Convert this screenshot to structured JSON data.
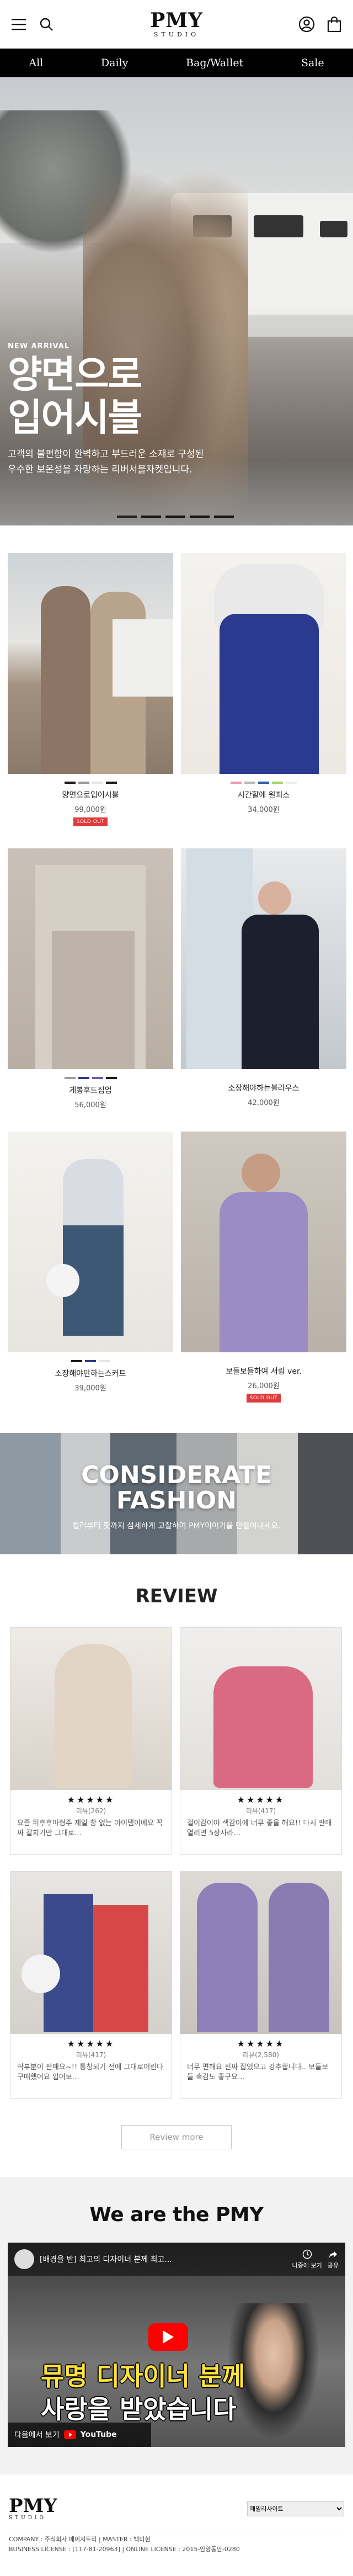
{
  "header": {
    "logo_main": "PMY",
    "logo_sub": "STUDIO"
  },
  "nav": {
    "items": [
      "All",
      "Daily",
      "Bag/Wallet",
      "Sale"
    ]
  },
  "hero": {
    "kicker": "NEW ARRIVAL",
    "title_line1": "양면으로",
    "title_line2": "입어시블",
    "desc_line1": "고객의 불편함이 완벽하고 부드러운 소재로 구성된",
    "desc_line2": "우수한 보온성을 자랑하는 리버서블자켓입니다."
  },
  "products": [
    {
      "name": "양면으로입어시블",
      "price": "99,000원",
      "soldout": "SOLD OUT",
      "swatches": [
        "#1a1a1a",
        "#9b9b9b",
        "#e7e7e7",
        "#1a1a1a"
      ]
    },
    {
      "name": "시간할애 원피스",
      "price": "34,000원",
      "soldout": "",
      "swatches": [
        "#e89ab8",
        "#b8b8b8",
        "#2f5ea8",
        "#a8d36a",
        "#ededed"
      ]
    },
    {
      "name": "게봉후드집업",
      "price": "56,000원",
      "soldout": "",
      "swatches": [
        "#9c9c9c",
        "#2d3a8c",
        "#6c5eab",
        "#1a1a1a"
      ]
    },
    {
      "name": "소장해야하는블라우스",
      "price": "42,000원",
      "soldout": "",
      "swatches": []
    },
    {
      "name": "소장해야만하는스커트",
      "price": "39,000원",
      "soldout": "",
      "swatches": [
        "#1a1a1a",
        "#2d3a8c",
        "#e6e6e6"
      ]
    },
    {
      "name": "보들보들하여 셔링 ver.",
      "price": "26,000원",
      "soldout": "SOLD OUT",
      "swatches": []
    }
  ],
  "banner": {
    "title_line1": "CONSIDERATE",
    "title_line2": "FASHION",
    "sub": "컬러부터 핏까지 섬세하게 고찰하여 PMY이야기를 만들어내세요."
  },
  "review": {
    "title": "REVIEW",
    "items": [
      {
        "stars": "★★★★★",
        "count": "리뷰(262)",
        "text": "요즘 뒤후후마형주 제일 창 없는 아이템이에요 꼭 짜 갈치기만 그대로…"
      },
      {
        "stars": "★★★★★",
        "count": "리뷰(417)",
        "text": "걸이감이야 색감이에 너무 좋을 해요!! 다시 판매 열리면 5장사라…"
      },
      {
        "stars": "★★★★★",
        "count": "리뷰(417)",
        "text": "딱부분이 판매요~!! 통칭되기 전에 그대로어린다 구매했어요 입어보…"
      },
      {
        "stars": "★★★★★",
        "count": "리뷰(2,580)",
        "text": "너무 편해요 진짜 잡었으고 강추합니다.. 보들보들 촉감도 좋구요…"
      }
    ],
    "more_label": "Review more"
  },
  "about": {
    "title": "We are the PMY",
    "video_title": "[배경을 반] 최고의 디자이너 분께 최고...",
    "share_label": "나중에 보기",
    "share_label2": "공유",
    "caption_line1": "뮤명 디자이너 분께",
    "caption_line2": "사랑을 받았습니다",
    "watch_label": "다음에서 보기",
    "watch_brand": "YouTube"
  },
  "footer": {
    "logo_main": "PMY",
    "logo_sub": "STUDIO",
    "family_site": "패밀리사이트",
    "info": "COMPANY : 주식회사 메이지트리    |    MASTER : 백미현",
    "info2": "BUSINESS LICENSE : [117-81-20963]    |    ONLINE LICENSE : 2015-안양동안-0280"
  },
  "colors": {
    "nav_bg": "#000000",
    "soldout": "#e03b3b"
  }
}
